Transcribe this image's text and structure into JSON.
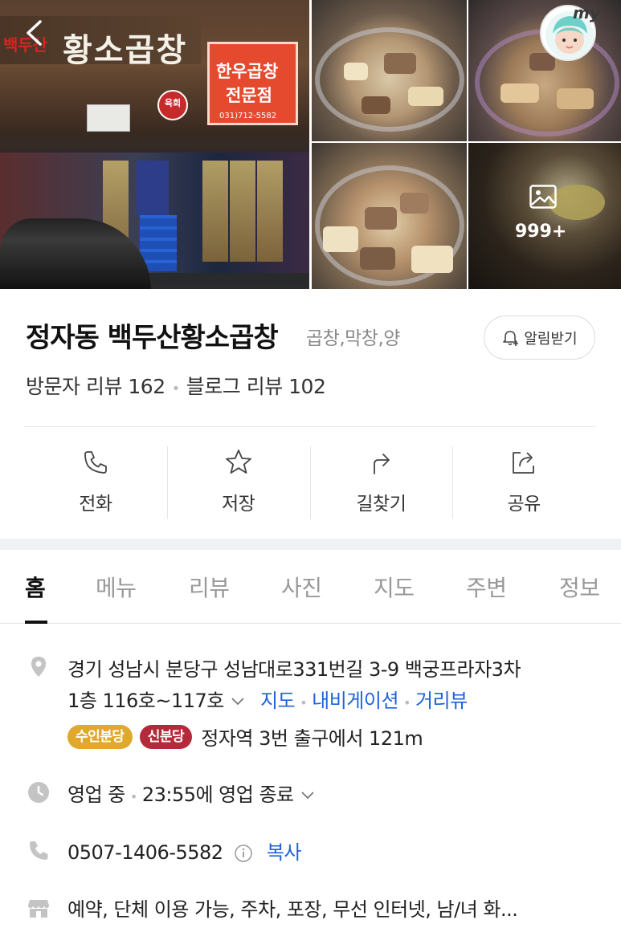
{
  "gallery": {
    "store_sign_sub": "백두산",
    "store_sign_text": "황소곱창",
    "board_line1": "한우곱창",
    "board_line2": "전문점",
    "board_phone": "031)712-5582",
    "circle_sign": "육회",
    "more_count": "999+",
    "my_label": "my"
  },
  "place": {
    "title": "정자동 백두산황소곱창",
    "category": "곱창,막창,양",
    "alarm_label": "알림받기",
    "visitor_reviews": "방문자 리뷰 162",
    "blog_reviews": "블로그 리뷰 102"
  },
  "actions": [
    {
      "label": "전화",
      "icon": "phone-icon"
    },
    {
      "label": "저장",
      "icon": "star-icon"
    },
    {
      "label": "길찾기",
      "icon": "directions-icon"
    },
    {
      "label": "공유",
      "icon": "share-icon"
    }
  ],
  "tabs": [
    "홈",
    "메뉴",
    "리뷰",
    "사진",
    "지도",
    "주변",
    "정보"
  ],
  "active_tab": "홈",
  "info": {
    "address_line1": "경기 성남시 분당구 성남대로331번길 3-9 백궁프라자3차",
    "address_line2": "1층 116호~117호",
    "map_link": "지도",
    "navigation_link": "내비게이션",
    "street_view_link": "거리뷰",
    "subway_badge1": "수인분당",
    "subway_badge1_color": "#e0a92c",
    "subway_badge2": "신분당",
    "subway_badge2_color": "#b52a3a",
    "subway_text": "정자역 3번 출구에서 121m",
    "hours_status": "영업 중",
    "hours_detail": "23:55에 영업 종료",
    "phone": "0507-1406-5582",
    "copy_label": "복사",
    "amenities": "예약, 단체 이용 가능, 주차, 포장, 무선 인터넷, 남/녀 화..."
  },
  "colors": {
    "link": "#1f63d8",
    "tab_active": "#111111",
    "tab_inactive": "#999999"
  }
}
